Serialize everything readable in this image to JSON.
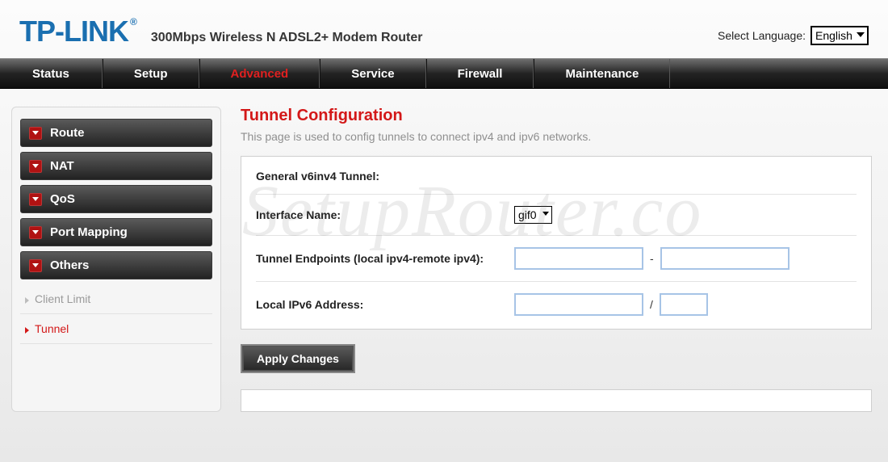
{
  "brand": {
    "name": "TP-LINK",
    "reg": "®"
  },
  "subtitle": "300Mbps Wireless N ADSL2+ Modem Router",
  "lang": {
    "label": "Select Language:",
    "value": "English"
  },
  "topnav": {
    "status": "Status",
    "setup": "Setup",
    "advanced": "Advanced",
    "service": "Service",
    "firewall": "Firewall",
    "maintenance": "Maintenance"
  },
  "sidebar": {
    "route": "Route",
    "nat": "NAT",
    "qos": "QoS",
    "portmapping": "Port Mapping",
    "others": "Others",
    "clientlimit": "Client Limit",
    "tunnel": "Tunnel"
  },
  "page": {
    "title": "Tunnel Configuration",
    "desc": "This page is used to config tunnels to connect ipv4 and ipv6 networks."
  },
  "form": {
    "section_label": "General v6inv4 Tunnel:",
    "iface_label": "Interface Name:",
    "iface_value": "gif0",
    "endpoints_label": "Tunnel Endpoints (local ipv4-remote ipv4):",
    "dash": "-",
    "ipv6_label": "Local IPv6 Address:",
    "slash": "/"
  },
  "buttons": {
    "apply": "Apply Changes"
  },
  "watermark": "SetupRouter.co"
}
